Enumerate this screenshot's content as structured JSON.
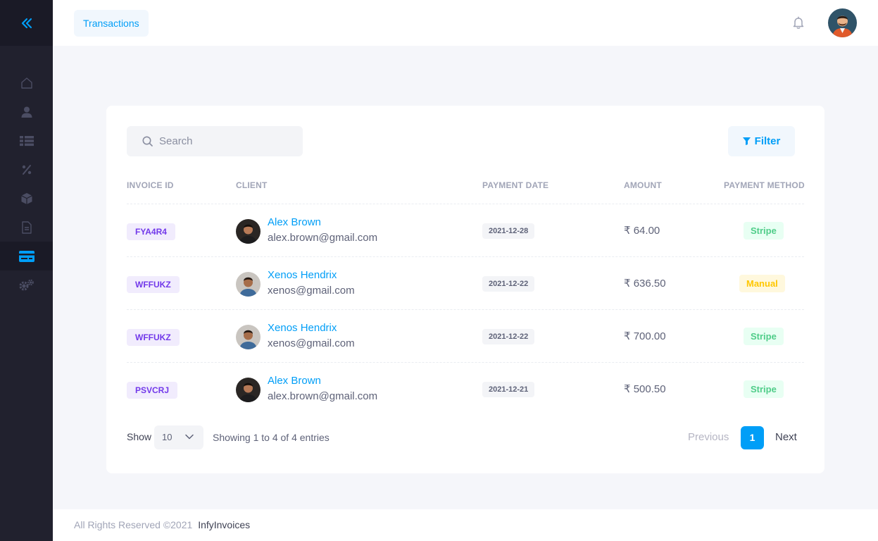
{
  "topbar": {
    "tab_label": "Transactions"
  },
  "search": {
    "placeholder": "Search"
  },
  "filter": {
    "label": "Filter"
  },
  "table": {
    "headers": [
      "INVOICE ID",
      "CLIENT",
      "PAYMENT DATE",
      "AMOUNT",
      "PAYMENT METHOD"
    ],
    "rows": [
      {
        "invoice_id": "FYA4R4",
        "client_name": "Alex Brown",
        "client_email": "alex.brown@gmail.com",
        "payment_date": "2021-12-28",
        "amount": "₹ 64.00",
        "method": "Stripe"
      },
      {
        "invoice_id": "WFFUKZ",
        "client_name": "Xenos Hendrix",
        "client_email": "xenos@gmail.com",
        "payment_date": "2021-12-22",
        "amount": "₹ 636.50",
        "method": "Manual"
      },
      {
        "invoice_id": "WFFUKZ",
        "client_name": "Xenos Hendrix",
        "client_email": "xenos@gmail.com",
        "payment_date": "2021-12-22",
        "amount": "₹ 700.00",
        "method": "Stripe"
      },
      {
        "invoice_id": "PSVCRJ",
        "client_name": "Alex Brown",
        "client_email": "alex.brown@gmail.com",
        "payment_date": "2021-12-21",
        "amount": "₹ 500.50",
        "method": "Stripe"
      }
    ]
  },
  "pagination": {
    "show_label": "Show",
    "page_size": "10",
    "showing_text": "Showing 1 to 4 of 4 entries",
    "previous": "Previous",
    "current_page": "1",
    "next": "Next"
  },
  "footer": {
    "copyright": "All Rights Reserved ©2021",
    "brand": "InfyInvoices"
  },
  "colors": {
    "accent": "#009ef7",
    "sidebar": "#21212e",
    "invoice_badge": "#7239ea",
    "stripe": "#50cd89",
    "manual": "#ffc700"
  },
  "icons": [
    "double-chevron-left-icon",
    "home-icon",
    "user-icon",
    "list-icon",
    "percent-icon",
    "box-icon",
    "document-icon",
    "credit-card-icon",
    "gears-icon",
    "bell-icon",
    "search-icon",
    "filter-icon",
    "chevron-down-icon"
  ]
}
